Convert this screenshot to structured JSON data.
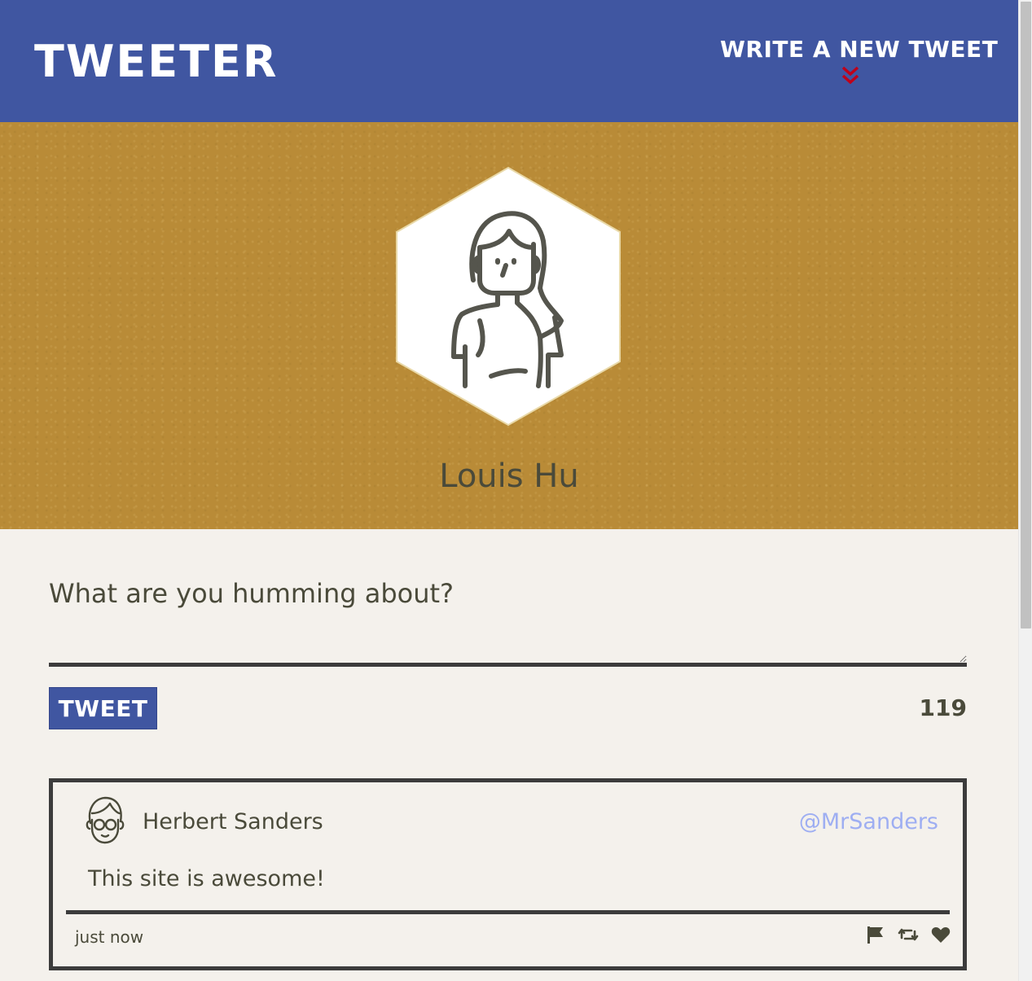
{
  "nav": {
    "brand": "TWEETER",
    "compose_label": "WRITE A NEW TWEET",
    "compose_icon": "double-chevron-down-icon",
    "accent": "#4056a1",
    "chevron_color": "#c0001a"
  },
  "profile": {
    "name": "Louis Hu",
    "avatar_icon": "woman-avatar-icon",
    "banner_color": "#b98b37"
  },
  "composer": {
    "prompt": "What are you humming about?",
    "input_value": "",
    "button_label": "TWEET",
    "char_counter": "119"
  },
  "tweets": [
    {
      "author": "Herbert Sanders",
      "handle": "@MrSanders",
      "text": "This site is awesome!",
      "timestamp": "just now",
      "avatar_icon": "man-with-glasses-avatar-icon",
      "actions": [
        "flag-icon",
        "retweet-icon",
        "heart-icon"
      ]
    }
  ]
}
